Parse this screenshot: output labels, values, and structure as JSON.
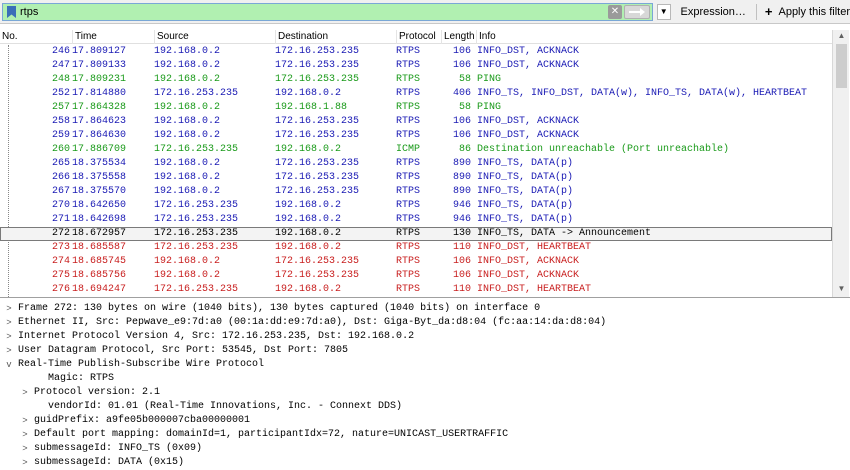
{
  "filter": {
    "value": "rtps",
    "expression_label": "Expression…",
    "plus_label": "+",
    "apply_label": "Apply this filter"
  },
  "columns": [
    "No.",
    "Time",
    "Source",
    "Destination",
    "Protocol",
    "Length",
    "Info"
  ],
  "packets": [
    {
      "no": "246",
      "time": "17.809127",
      "src": "192.168.0.2",
      "dst": "172.16.253.235",
      "proto": "RTPS",
      "len": "106",
      "info": "INFO_DST, ACKNACK",
      "color": "#1a1ab4"
    },
    {
      "no": "247",
      "time": "17.809133",
      "src": "192.168.0.2",
      "dst": "172.16.253.235",
      "proto": "RTPS",
      "len": "106",
      "info": "INFO_DST, ACKNACK",
      "color": "#1a1ab4"
    },
    {
      "no": "248",
      "time": "17.809231",
      "src": "192.168.0.2",
      "dst": "172.16.253.235",
      "proto": "RTPS",
      "len": "58",
      "info": "PING",
      "color": "#1a9a1a"
    },
    {
      "no": "252",
      "time": "17.814880",
      "src": "172.16.253.235",
      "dst": "192.168.0.2",
      "proto": "RTPS",
      "len": "406",
      "info": "INFO_TS, INFO_DST, DATA(w), INFO_TS, DATA(w), HEARTBEAT",
      "color": "#1a1ab4"
    },
    {
      "no": "257",
      "time": "17.864328",
      "src": "192.168.0.2",
      "dst": "192.168.1.88",
      "proto": "RTPS",
      "len": "58",
      "info": "PING",
      "color": "#1a9a1a"
    },
    {
      "no": "258",
      "time": "17.864623",
      "src": "192.168.0.2",
      "dst": "172.16.253.235",
      "proto": "RTPS",
      "len": "106",
      "info": "INFO_DST, ACKNACK",
      "color": "#1a1ab4"
    },
    {
      "no": "259",
      "time": "17.864630",
      "src": "192.168.0.2",
      "dst": "172.16.253.235",
      "proto": "RTPS",
      "len": "106",
      "info": "INFO_DST, ACKNACK",
      "color": "#1a1ab4"
    },
    {
      "no": "260",
      "time": "17.886709",
      "src": "172.16.253.235",
      "dst": "192.168.0.2",
      "proto": "ICMP",
      "len": "86",
      "info": "Destination unreachable (Port unreachable)",
      "color": "#1a9a1a"
    },
    {
      "no": "265",
      "time": "18.375534",
      "src": "192.168.0.2",
      "dst": "172.16.253.235",
      "proto": "RTPS",
      "len": "890",
      "info": "INFO_TS, DATA(p)",
      "color": "#1a1ab4"
    },
    {
      "no": "266",
      "time": "18.375558",
      "src": "192.168.0.2",
      "dst": "172.16.253.235",
      "proto": "RTPS",
      "len": "890",
      "info": "INFO_TS, DATA(p)",
      "color": "#1a1ab4"
    },
    {
      "no": "267",
      "time": "18.375570",
      "src": "192.168.0.2",
      "dst": "172.16.253.235",
      "proto": "RTPS",
      "len": "890",
      "info": "INFO_TS, DATA(p)",
      "color": "#1a1ab4"
    },
    {
      "no": "270",
      "time": "18.642650",
      "src": "172.16.253.235",
      "dst": "192.168.0.2",
      "proto": "RTPS",
      "len": "946",
      "info": "INFO_TS, DATA(p)",
      "color": "#1a1ab4"
    },
    {
      "no": "271",
      "time": "18.642698",
      "src": "172.16.253.235",
      "dst": "192.168.0.2",
      "proto": "RTPS",
      "len": "946",
      "info": "INFO_TS, DATA(p)",
      "color": "#1a1ab4"
    },
    {
      "no": "272",
      "time": "18.672957",
      "src": "172.16.253.235",
      "dst": "192.168.0.2",
      "proto": "RTPS",
      "len": "130",
      "info": "INFO_TS, DATA -> Announcement",
      "color": "#000000",
      "selected": true
    },
    {
      "no": "273",
      "time": "18.685587",
      "src": "172.16.253.235",
      "dst": "192.168.0.2",
      "proto": "RTPS",
      "len": "110",
      "info": "INFO_DST, HEARTBEAT",
      "color": "#c81e1e"
    },
    {
      "no": "274",
      "time": "18.685745",
      "src": "192.168.0.2",
      "dst": "172.16.253.235",
      "proto": "RTPS",
      "len": "106",
      "info": "INFO_DST, ACKNACK",
      "color": "#c81e1e"
    },
    {
      "no": "275",
      "time": "18.685756",
      "src": "192.168.0.2",
      "dst": "172.16.253.235",
      "proto": "RTPS",
      "len": "106",
      "info": "INFO_DST, ACKNACK",
      "color": "#c81e1e"
    },
    {
      "no": "276",
      "time": "18.694247",
      "src": "172.16.253.235",
      "dst": "192.168.0.2",
      "proto": "RTPS",
      "len": "110",
      "info": "INFO_DST, HEARTBEAT",
      "color": "#c81e1e"
    }
  ],
  "details": [
    {
      "level": 0,
      "expander": ">",
      "text": "Frame 272: 130 bytes on wire (1040 bits), 130 bytes captured (1040 bits) on interface 0"
    },
    {
      "level": 0,
      "expander": ">",
      "text": "Ethernet II, Src: Pepwave_e9:7d:a0 (00:1a:dd:e9:7d:a0), Dst: Giga-Byt_da:d8:04 (fc:aa:14:da:d8:04)"
    },
    {
      "level": 0,
      "expander": ">",
      "text": "Internet Protocol Version 4, Src: 172.16.253.235, Dst: 192.168.0.2"
    },
    {
      "level": 0,
      "expander": ">",
      "text": "User Datagram Protocol, Src Port: 53545, Dst Port: 7805"
    },
    {
      "level": 0,
      "expander": "v",
      "text": "Real-Time Publish-Subscribe Wire Protocol"
    },
    {
      "level": 2,
      "expander": "",
      "text": "Magic: RTPS"
    },
    {
      "level": 1,
      "expander": ">",
      "text": "Protocol version: 2.1"
    },
    {
      "level": 2,
      "expander": "",
      "text": "vendorId: 01.01 (Real-Time Innovations, Inc. - Connext DDS)"
    },
    {
      "level": 1,
      "expander": ">",
      "text": "guidPrefix: a9fe05b000007cba00000001"
    },
    {
      "level": 1,
      "expander": ">",
      "text": "Default port mapping: domainId=1, participantIdx=72, nature=UNICAST_USERTRAFFIC"
    },
    {
      "level": 1,
      "expander": ">",
      "text": "submessageId: INFO_TS (0x09)"
    },
    {
      "level": 1,
      "expander": ">",
      "text": "submessageId: DATA (0x15)"
    }
  ]
}
